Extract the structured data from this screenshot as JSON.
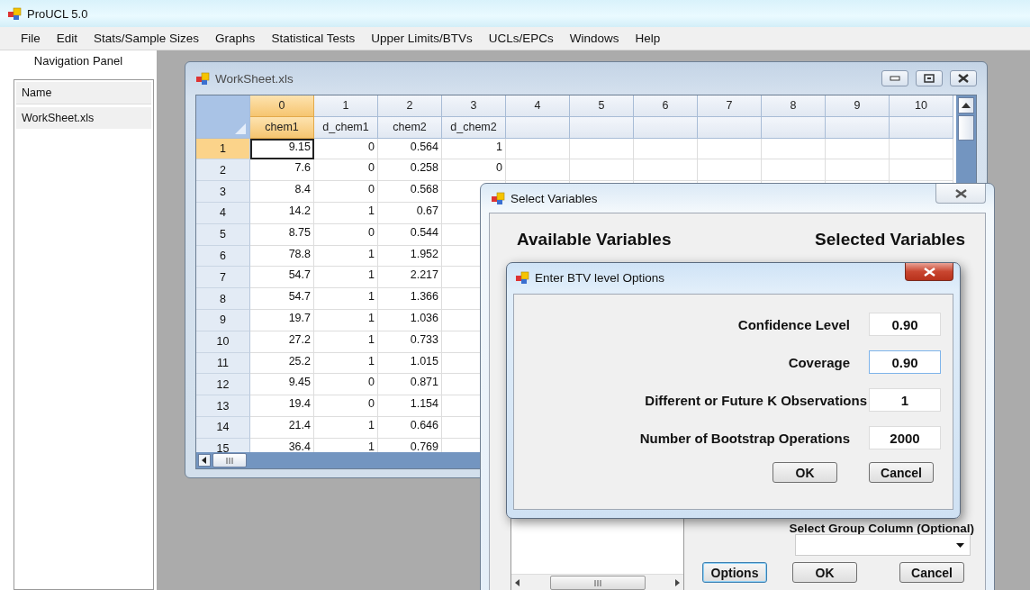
{
  "window": {
    "title": "ProUCL 5.0"
  },
  "menu": [
    "File",
    "Edit",
    "Stats/Sample Sizes",
    "Graphs",
    "Statistical Tests",
    "Upper Limits/BTVs",
    "UCLs/EPCs",
    "Windows",
    "Help"
  ],
  "navigation_panel": {
    "title": "Navigation Panel",
    "list_header": "Name",
    "items": [
      "WorkSheet.xls"
    ]
  },
  "worksheet": {
    "title": "WorkSheet.xls",
    "columns": [
      {
        "index": "0",
        "name": "chem1",
        "selected": true
      },
      {
        "index": "1",
        "name": "d_chem1",
        "selected": false
      },
      {
        "index": "2",
        "name": "chem2",
        "selected": false
      },
      {
        "index": "3",
        "name": "d_chem2",
        "selected": false
      },
      {
        "index": "4",
        "selected": false
      },
      {
        "index": "5",
        "selected": false
      },
      {
        "index": "6",
        "selected": false
      },
      {
        "index": "7",
        "selected": false
      },
      {
        "index": "8",
        "selected": false
      },
      {
        "index": "9",
        "selected": false
      },
      {
        "index": "10",
        "selected": false
      }
    ],
    "rows": [
      {
        "label": "1",
        "selected": true,
        "cells": [
          "9.15",
          "0",
          "0.564",
          "1"
        ]
      },
      {
        "label": "2",
        "selected": false,
        "cells": [
          "7.6",
          "0",
          "0.258",
          "0"
        ]
      },
      {
        "label": "3",
        "selected": false,
        "cells": [
          "8.4",
          "0",
          "0.568"
        ]
      },
      {
        "label": "4",
        "selected": false,
        "cells": [
          "14.2",
          "1",
          "0.67"
        ]
      },
      {
        "label": "5",
        "selected": false,
        "cells": [
          "8.75",
          "0",
          "0.544"
        ]
      },
      {
        "label": "6",
        "selected": false,
        "cells": [
          "78.8",
          "1",
          "1.952"
        ]
      },
      {
        "label": "7",
        "selected": false,
        "cells": [
          "54.7",
          "1",
          "2.217"
        ]
      },
      {
        "label": "8",
        "selected": false,
        "cells": [
          "54.7",
          "1",
          "1.366"
        ]
      },
      {
        "label": "9",
        "selected": false,
        "cells": [
          "19.7",
          "1",
          "1.036"
        ]
      },
      {
        "label": "10",
        "selected": false,
        "cells": [
          "27.2",
          "1",
          "0.733"
        ]
      },
      {
        "label": "11",
        "selected": false,
        "cells": [
          "25.2",
          "1",
          "1.015"
        ]
      },
      {
        "label": "12",
        "selected": false,
        "cells": [
          "9.45",
          "0",
          "0.871"
        ]
      },
      {
        "label": "13",
        "selected": false,
        "cells": [
          "19.4",
          "0",
          "1.154"
        ]
      },
      {
        "label": "14",
        "selected": false,
        "cells": [
          "21.4",
          "1",
          "0.646"
        ]
      },
      {
        "label": "15",
        "selected": false,
        "cells": [
          "36.4",
          "1",
          "0.769"
        ]
      }
    ]
  },
  "select_variables": {
    "title": "Select Variables",
    "available_heading": "Available Variables",
    "selected_heading": "Selected Variables",
    "group_label": "Select Group Column (Optional)",
    "buttons": [
      {
        "label": "Options",
        "focused": true
      },
      {
        "label": "OK",
        "focused": false
      },
      {
        "label": "Cancel",
        "focused": false
      }
    ]
  },
  "btv_dialog": {
    "title": "Enter BTV level Options",
    "fields": [
      {
        "label": "Confidence Level",
        "value": "0.90",
        "focused": false
      },
      {
        "label": "Coverage",
        "value": "0.90",
        "focused": true
      },
      {
        "label": "Different or Future K Observations",
        "value": "1",
        "focused": false
      },
      {
        "label": "Number of Bootstrap Operations",
        "value": "2000",
        "focused": false
      }
    ],
    "buttons": [
      "OK",
      "Cancel"
    ]
  }
}
